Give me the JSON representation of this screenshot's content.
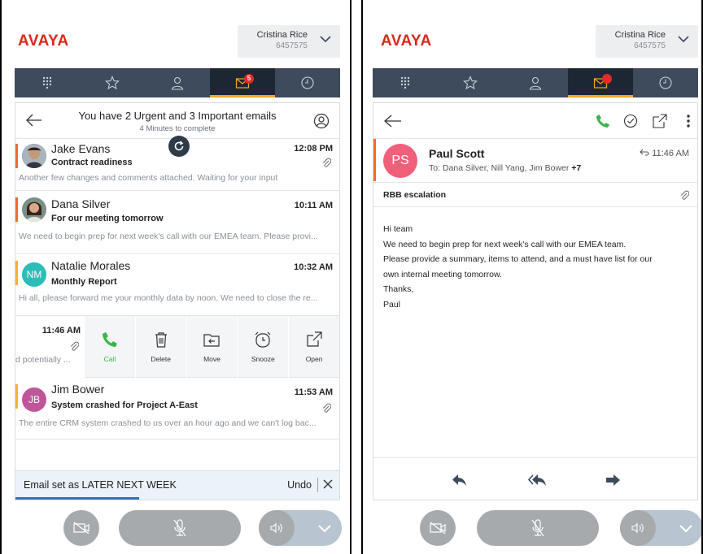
{
  "colors": {
    "brand": "#da291c",
    "urgent": "#f26b2a",
    "important": "#f5b335",
    "call_green": "#39b54a",
    "tabbar": "#3d4b5c"
  },
  "left": {
    "brand": "AVAYA",
    "user": {
      "name": "Cristina Rice",
      "extension": "6457575"
    },
    "tabs": [
      {
        "icon": "dialpad-icon"
      },
      {
        "icon": "star-icon"
      },
      {
        "icon": "contact-icon"
      },
      {
        "icon": "mail-icon",
        "badge": "5",
        "active": true
      },
      {
        "icon": "clock-icon"
      }
    ],
    "header": {
      "title": "You have 2 Urgent and 3 Important emails",
      "subtitle": "4 Minutes to complete"
    },
    "emails": [
      {
        "sender": "Jake Evans",
        "subject": "Contract readiness",
        "time": "12:08 PM",
        "preview": "Another few changes and comments attached. Waiting for your input",
        "priority": "urgent",
        "attachment": true,
        "avatar": "photo"
      },
      {
        "sender": "Dana Silver",
        "subject": "For our meeting tomorrow",
        "time": "10:11 AM",
        "preview": "We need to begin prep for next week's call with our EMEA team. Please provi...",
        "priority": "urgent",
        "attachment": false,
        "avatar": "photo"
      },
      {
        "sender": "Natalie Morales",
        "subject": "Monthly Report",
        "time": "10:32 AM",
        "preview": "Hi all, please forward me your monthly data by noon. We need to close the re...",
        "priority": "important",
        "attachment": false,
        "avatar": "NM",
        "avatar_color": "#2bbdb6"
      },
      {
        "sender": "Jim Bower",
        "subject": "System crashed for Project A-East",
        "time": "11:53 AM",
        "preview": "The entire CRM system crashed to us over an hour ago and we can't log bac...",
        "priority": "important",
        "attachment": true,
        "avatar": "JB",
        "avatar_color": "#c0569a"
      }
    ],
    "swiped": {
      "time": "11:46 AM",
      "preview": "d potentially ...",
      "actions": [
        {
          "label": "Call",
          "icon": "phone-icon"
        },
        {
          "label": "Delete",
          "icon": "trash-icon"
        },
        {
          "label": "Move",
          "icon": "folder-move-icon"
        },
        {
          "label": "Snooze",
          "icon": "alarm-icon"
        },
        {
          "label": "Open",
          "icon": "open-external-icon"
        }
      ]
    },
    "toast": {
      "text": "Email set as LATER NEXT WEEK",
      "undo": "Undo"
    }
  },
  "right": {
    "brand": "AVAYA",
    "user": {
      "name": "Cristina Rice",
      "extension": "6457575"
    },
    "message": {
      "initials": "PS",
      "from": "Paul Scott",
      "to_prefix": "To: ",
      "to": "Dana Silver, Nill Yang, Jim Bower",
      "to_more": "+7",
      "time": "11:46 AM",
      "subject": "RBB escalation",
      "body": [
        "Hi team",
        "We need to begin prep for next week's call with our EMEA team.",
        "Please provide a summary, items to attend, and a must have list for our",
        "own internal meeting tomorrow.",
        "Thanks,",
        "Paul"
      ]
    }
  }
}
